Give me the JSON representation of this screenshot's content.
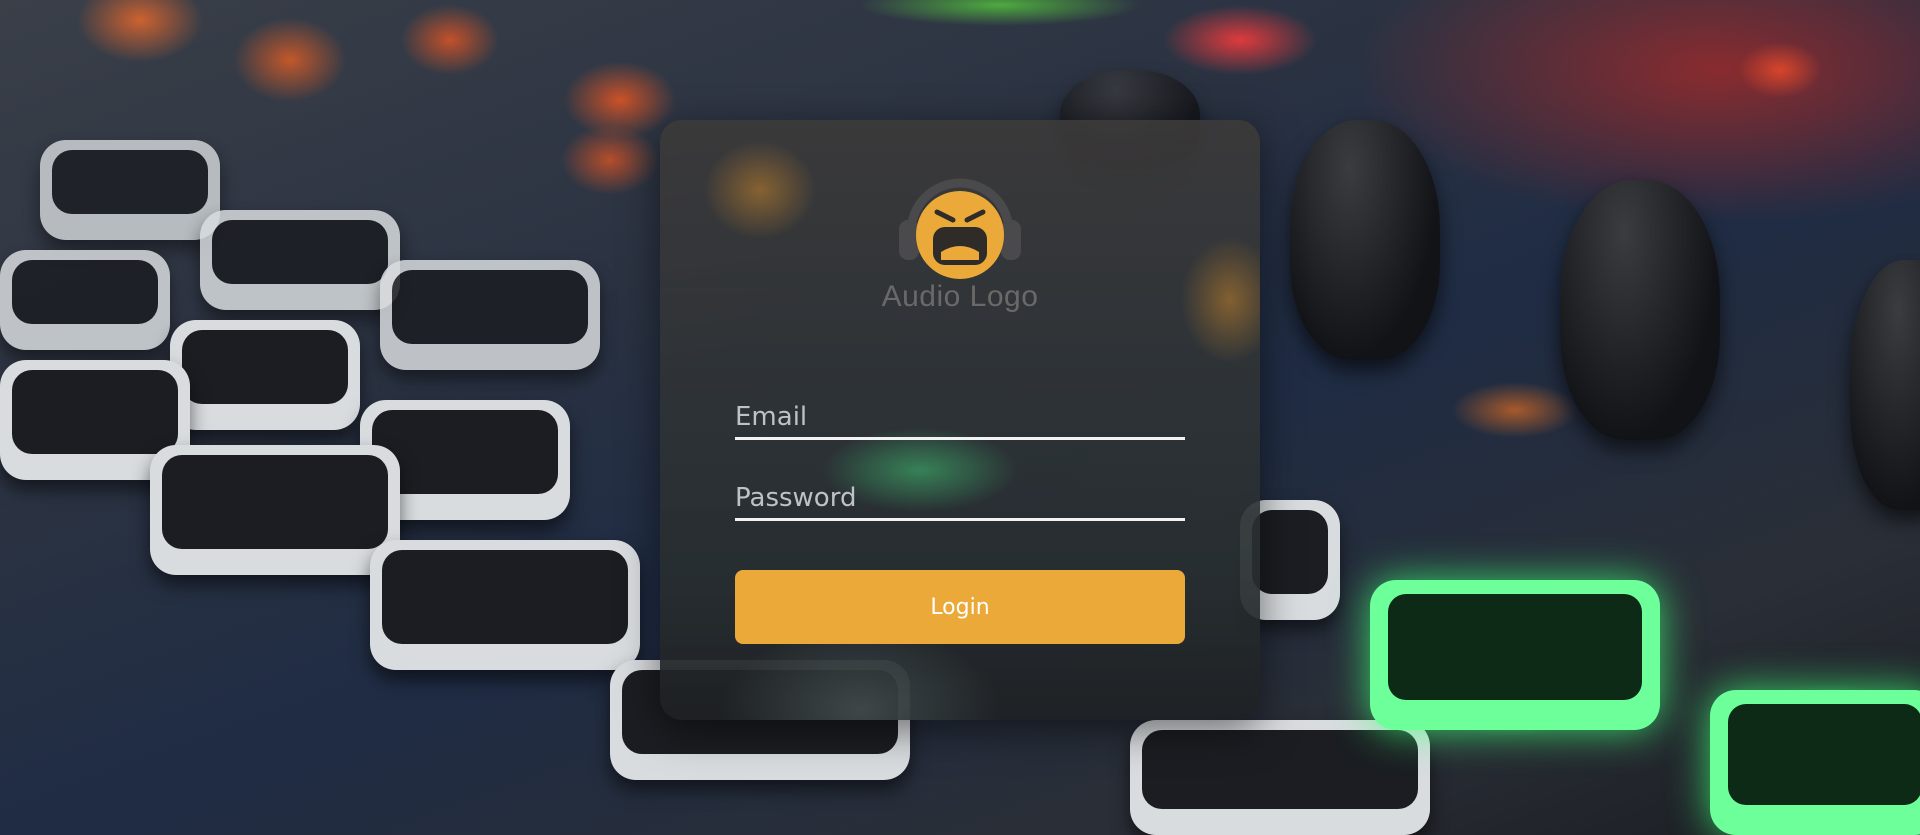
{
  "login": {
    "logo_icon": "headphones-mascot-icon",
    "logo_text": "Audio Logo",
    "email_placeholder": "Email",
    "email_value": "",
    "password_placeholder": "Password",
    "password_value": "",
    "login_label": "Login"
  },
  "colors": {
    "accent": "#eba93a",
    "underline": "#f2f2f2",
    "logo_text": "#82807c"
  }
}
